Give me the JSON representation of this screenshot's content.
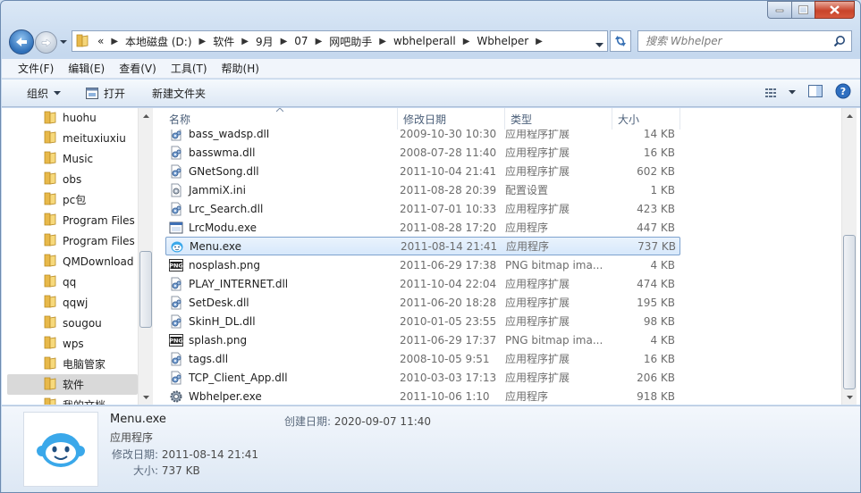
{
  "address": {
    "crumbs": [
      "本地磁盘 (D:)",
      "软件",
      "9月",
      "07",
      "网吧助手",
      "wbhelperall",
      "Wbhelper"
    ],
    "overflow": "«"
  },
  "search": {
    "placeholder": "搜索 Wbhelper"
  },
  "menubar": {
    "items": [
      "文件(F)",
      "编辑(E)",
      "查看(V)",
      "工具(T)",
      "帮助(H)"
    ]
  },
  "toolbar": {
    "organize": "组织",
    "open": "打开",
    "new_folder": "新建文件夹"
  },
  "nav": {
    "items": [
      {
        "label": "huohu"
      },
      {
        "label": "meituxiuxiu"
      },
      {
        "label": "Music"
      },
      {
        "label": "obs"
      },
      {
        "label": "pc包"
      },
      {
        "label": "Program Files"
      },
      {
        "label": "Program Files"
      },
      {
        "label": "QMDownload"
      },
      {
        "label": "qq"
      },
      {
        "label": "qqwj"
      },
      {
        "label": "sougou"
      },
      {
        "label": "wps"
      },
      {
        "label": "电脑管家"
      },
      {
        "label": "软件",
        "selected": true
      },
      {
        "label": "我的文档"
      }
    ]
  },
  "columns": {
    "name": "名称",
    "date": "修改日期",
    "type": "类型",
    "size": "大小"
  },
  "files": [
    {
      "name": "bass_wadsp.dll",
      "date": "2009-10-30 10:30",
      "type": "应用程序扩展",
      "size": "14 KB",
      "icon": "dll-icon"
    },
    {
      "name": "basswma.dll",
      "date": "2008-07-28 11:40",
      "type": "应用程序扩展",
      "size": "16 KB",
      "icon": "dll-icon"
    },
    {
      "name": "GNetSong.dll",
      "date": "2011-10-04 21:41",
      "type": "应用程序扩展",
      "size": "602 KB",
      "icon": "dll-icon"
    },
    {
      "name": "JammiX.ini",
      "date": "2011-08-28 20:39",
      "type": "配置设置",
      "size": "1 KB",
      "icon": "ini-icon"
    },
    {
      "name": "Lrc_Search.dll",
      "date": "2011-07-01 10:33",
      "type": "应用程序扩展",
      "size": "423 KB",
      "icon": "dll-icon"
    },
    {
      "name": "LrcModu.exe",
      "date": "2011-08-28 17:20",
      "type": "应用程序",
      "size": "447 KB",
      "icon": "exe-icon"
    },
    {
      "name": "Menu.exe",
      "date": "2011-08-14 21:41",
      "type": "应用程序",
      "size": "737 KB",
      "icon": "smiley-app-icon",
      "selected": true
    },
    {
      "name": "nosplash.png",
      "date": "2011-06-29 17:38",
      "type": "PNG bitmap ima...",
      "size": "4 KB",
      "icon": "png-icon"
    },
    {
      "name": "PLAY_INTERNET.dll",
      "date": "2011-10-04 22:04",
      "type": "应用程序扩展",
      "size": "474 KB",
      "icon": "dll-icon"
    },
    {
      "name": "SetDesk.dll",
      "date": "2011-06-20 18:28",
      "type": "应用程序扩展",
      "size": "195 KB",
      "icon": "dll-icon"
    },
    {
      "name": "SkinH_DL.dll",
      "date": "2010-01-05 23:55",
      "type": "应用程序扩展",
      "size": "98 KB",
      "icon": "dll-icon"
    },
    {
      "name": "splash.png",
      "date": "2011-06-29 17:37",
      "type": "PNG bitmap ima...",
      "size": "4 KB",
      "icon": "png-icon"
    },
    {
      "name": "tags.dll",
      "date": "2008-10-05 9:51",
      "type": "应用程序扩展",
      "size": "16 KB",
      "icon": "dll-icon"
    },
    {
      "name": "TCP_Client_App.dll",
      "date": "2010-03-03 17:13",
      "type": "应用程序扩展",
      "size": "206 KB",
      "icon": "dll-icon"
    },
    {
      "name": "Wbhelper.exe",
      "date": "2011-10-06 1:10",
      "type": "应用程序",
      "size": "918 KB",
      "icon": "gear-app-icon"
    }
  ],
  "details": {
    "name": "Menu.exe",
    "type": "应用程序",
    "modified_label": "修改日期:",
    "modified": "2011-08-14 21:41",
    "size_label": "大小:",
    "size": "737 KB",
    "created_label": "创建日期:",
    "created": "2020-09-07 11:40"
  },
  "colors": {
    "selection_bg": "#d7e8fb",
    "selection_border": "#7da2ce",
    "close_button": "#c8442b",
    "window_frame": "#c5d8ee"
  }
}
